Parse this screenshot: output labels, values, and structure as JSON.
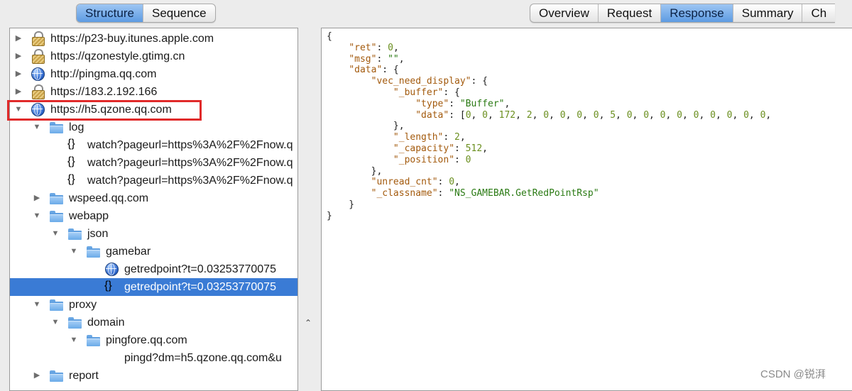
{
  "left_tabs": {
    "structure": "Structure",
    "sequence": "Sequence",
    "active": "structure"
  },
  "right_tabs": {
    "overview": "Overview",
    "request": "Request",
    "response": "Response",
    "summary": "Summary",
    "chart_truncated": "Ch",
    "active": "response"
  },
  "tree": [
    {
      "label": "https://p23-buy.itunes.apple.com",
      "icon": "lock-icon",
      "expanded": false,
      "level": 0
    },
    {
      "label": "https://qzonestyle.gtimg.cn",
      "icon": "lock-icon",
      "expanded": false,
      "level": 0
    },
    {
      "label": "http://pingma.qq.com",
      "icon": "globe-icon",
      "expanded": false,
      "level": 0
    },
    {
      "label": "https://183.2.192.166",
      "icon": "lock-icon",
      "expanded": false,
      "level": 0
    },
    {
      "label": "https://h5.qzone.qq.com",
      "icon": "globe-icon",
      "expanded": true,
      "level": 0,
      "highlighted": true
    },
    {
      "label": "log",
      "icon": "folder-icon",
      "expanded": true,
      "level": 1
    },
    {
      "label": "watch?pageurl=https%3A%2F%2Fnow.q",
      "icon": "json-doc-icon",
      "level": 2
    },
    {
      "label": "watch?pageurl=https%3A%2F%2Fnow.q",
      "icon": "json-doc-icon",
      "level": 2
    },
    {
      "label": "watch?pageurl=https%3A%2F%2Fnow.q",
      "icon": "json-doc-icon",
      "level": 2
    },
    {
      "label": "wspeed.qq.com",
      "icon": "folder-icon",
      "expanded": false,
      "level": 1
    },
    {
      "label": "webapp",
      "icon": "folder-icon",
      "expanded": true,
      "level": 1
    },
    {
      "label": "json",
      "icon": "folder-icon",
      "expanded": true,
      "level": 2
    },
    {
      "label": "gamebar",
      "icon": "folder-icon",
      "expanded": true,
      "level": 3
    },
    {
      "label": "getredpoint?t=0.03253770075",
      "icon": "globe-icon",
      "level": 4
    },
    {
      "label": "getredpoint?t=0.03253770075",
      "icon": "json-doc-icon",
      "level": 4,
      "selected": true
    },
    {
      "label": "proxy",
      "icon": "folder-icon",
      "expanded": true,
      "level": 1
    },
    {
      "label": "domain",
      "icon": "folder-icon",
      "expanded": true,
      "level": 2
    },
    {
      "label": "pingfore.qq.com",
      "icon": "folder-icon",
      "expanded": true,
      "level": 3
    },
    {
      "label": "pingd?dm=h5.qzone.qq.com&u",
      "icon": "blank-doc-icon",
      "level": 4
    },
    {
      "label": "report",
      "icon": "folder-icon",
      "expanded": false,
      "level": 1
    }
  ],
  "response_json": {
    "lines": [
      [
        {
          "t": "p",
          "v": "{"
        }
      ],
      [
        {
          "t": "p",
          "v": "    "
        },
        {
          "t": "k",
          "v": "\"ret\""
        },
        {
          "t": "p",
          "v": ": "
        },
        {
          "t": "n",
          "v": "0"
        },
        {
          "t": "p",
          "v": ","
        }
      ],
      [
        {
          "t": "p",
          "v": "    "
        },
        {
          "t": "k",
          "v": "\"msg\""
        },
        {
          "t": "p",
          "v": ": "
        },
        {
          "t": "s",
          "v": "\"\""
        },
        {
          "t": "p",
          "v": ","
        }
      ],
      [
        {
          "t": "p",
          "v": "    "
        },
        {
          "t": "k",
          "v": "\"data\""
        },
        {
          "t": "p",
          "v": ": {"
        }
      ],
      [
        {
          "t": "p",
          "v": "        "
        },
        {
          "t": "k",
          "v": "\"vec_need_display\""
        },
        {
          "t": "p",
          "v": ": {"
        }
      ],
      [
        {
          "t": "p",
          "v": "            "
        },
        {
          "t": "k",
          "v": "\"_buffer\""
        },
        {
          "t": "p",
          "v": ": {"
        }
      ],
      [
        {
          "t": "p",
          "v": "                "
        },
        {
          "t": "k",
          "v": "\"type\""
        },
        {
          "t": "p",
          "v": ": "
        },
        {
          "t": "s",
          "v": "\"Buffer\""
        },
        {
          "t": "p",
          "v": ","
        }
      ],
      [
        {
          "t": "p",
          "v": "                "
        },
        {
          "t": "k",
          "v": "\"data\""
        },
        {
          "t": "p",
          "v": ": ["
        },
        {
          "t": "n",
          "v": "0"
        },
        {
          "t": "p",
          "v": ", "
        },
        {
          "t": "n",
          "v": "0"
        },
        {
          "t": "p",
          "v": ", "
        },
        {
          "t": "n",
          "v": "172"
        },
        {
          "t": "p",
          "v": ", "
        },
        {
          "t": "n",
          "v": "2"
        },
        {
          "t": "p",
          "v": ", "
        },
        {
          "t": "n",
          "v": "0"
        },
        {
          "t": "p",
          "v": ", "
        },
        {
          "t": "n",
          "v": "0"
        },
        {
          "t": "p",
          "v": ", "
        },
        {
          "t": "n",
          "v": "0"
        },
        {
          "t": "p",
          "v": ", "
        },
        {
          "t": "n",
          "v": "0"
        },
        {
          "t": "p",
          "v": ", "
        },
        {
          "t": "n",
          "v": "5"
        },
        {
          "t": "p",
          "v": ", "
        },
        {
          "t": "n",
          "v": "0"
        },
        {
          "t": "p",
          "v": ", "
        },
        {
          "t": "n",
          "v": "0"
        },
        {
          "t": "p",
          "v": ", "
        },
        {
          "t": "n",
          "v": "0"
        },
        {
          "t": "p",
          "v": ", "
        },
        {
          "t": "n",
          "v": "0"
        },
        {
          "t": "p",
          "v": ", "
        },
        {
          "t": "n",
          "v": "0"
        },
        {
          "t": "p",
          "v": ", "
        },
        {
          "t": "n",
          "v": "0"
        },
        {
          "t": "p",
          "v": ", "
        },
        {
          "t": "n",
          "v": "0"
        },
        {
          "t": "p",
          "v": ", "
        },
        {
          "t": "n",
          "v": "0"
        },
        {
          "t": "p",
          "v": ", "
        },
        {
          "t": "n",
          "v": "0"
        },
        {
          "t": "p",
          "v": ","
        }
      ],
      [
        {
          "t": "p",
          "v": "            },"
        }
      ],
      [
        {
          "t": "p",
          "v": "            "
        },
        {
          "t": "k",
          "v": "\"_length\""
        },
        {
          "t": "p",
          "v": ": "
        },
        {
          "t": "n",
          "v": "2"
        },
        {
          "t": "p",
          "v": ","
        }
      ],
      [
        {
          "t": "p",
          "v": "            "
        },
        {
          "t": "k",
          "v": "\"_capacity\""
        },
        {
          "t": "p",
          "v": ": "
        },
        {
          "t": "n",
          "v": "512"
        },
        {
          "t": "p",
          "v": ","
        }
      ],
      [
        {
          "t": "p",
          "v": "            "
        },
        {
          "t": "k",
          "v": "\"_position\""
        },
        {
          "t": "p",
          "v": ": "
        },
        {
          "t": "n",
          "v": "0"
        }
      ],
      [
        {
          "t": "p",
          "v": "        },"
        }
      ],
      [
        {
          "t": "p",
          "v": "        "
        },
        {
          "t": "k",
          "v": "\"unread_cnt\""
        },
        {
          "t": "p",
          "v": ": "
        },
        {
          "t": "n",
          "v": "0"
        },
        {
          "t": "p",
          "v": ","
        }
      ],
      [
        {
          "t": "p",
          "v": "        "
        },
        {
          "t": "k",
          "v": "\"_classname\""
        },
        {
          "t": "p",
          "v": ": "
        },
        {
          "t": "s",
          "v": "\"NS_GAMEBAR.GetRedPointRsp\""
        }
      ],
      [
        {
          "t": "p",
          "v": "    }"
        }
      ],
      [
        {
          "t": "p",
          "v": "}"
        }
      ]
    ]
  },
  "watermark": "CSDN @锐湃",
  "colors": {
    "selection": "#3a7bd5",
    "highlight_box": "#e02a2a",
    "json_key": "#a35a0d",
    "json_string": "#2a7a13",
    "json_number": "#6b8f1f"
  }
}
